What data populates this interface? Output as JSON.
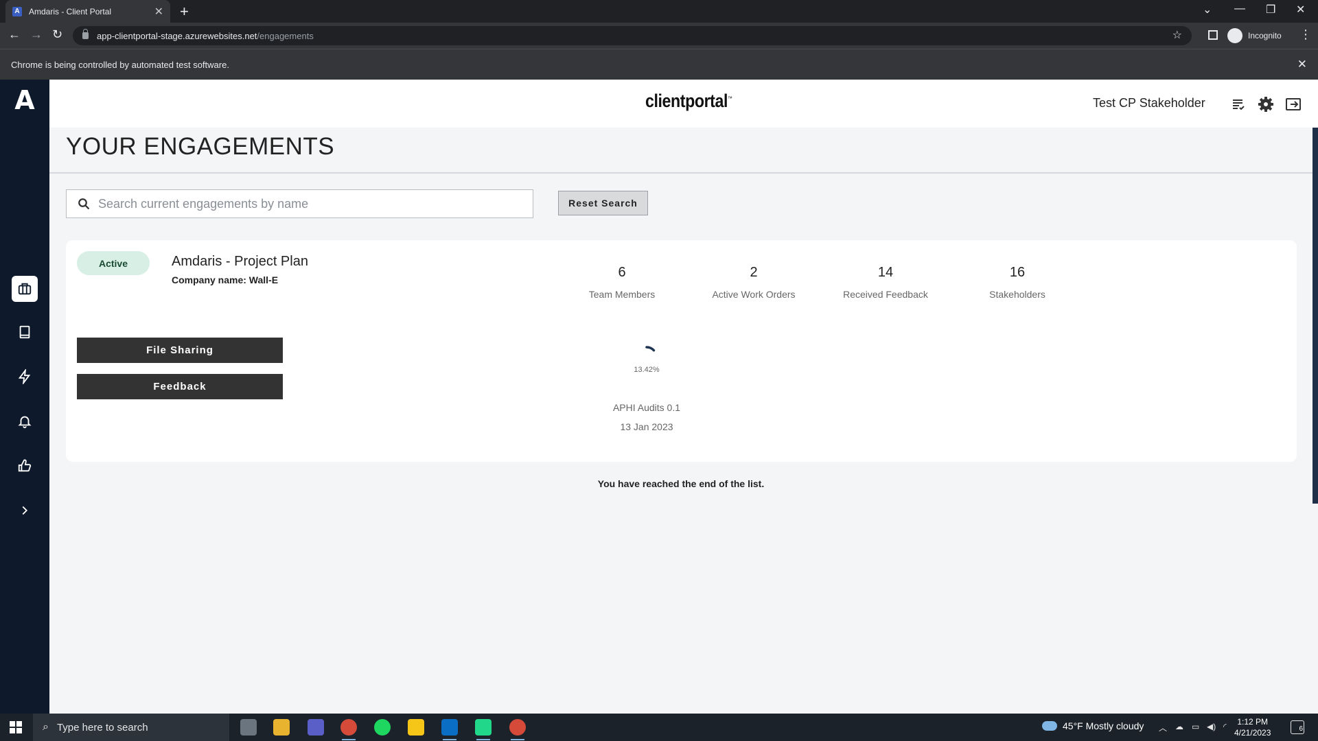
{
  "browser": {
    "tab_title": "Amdaris - Client Portal",
    "tab_favicon": "A",
    "url_host": "app-clientportal-stage.azurewebsites.net",
    "url_path": "/engagements",
    "profile_label": "Incognito",
    "infobar_text": "Chrome is being controlled by automated test software."
  },
  "app": {
    "logo_letter": "A",
    "brand_name": "clientportal",
    "brand_tm": "™",
    "user_name": "Test CP Stakeholder",
    "sidebar_icons": [
      "briefcase-icon",
      "book-icon",
      "lightning-icon",
      "bell-icon",
      "thumbs-up-icon",
      "chevron-right-icon"
    ],
    "header_icons": [
      "task-list-icon",
      "gear-icon",
      "logout-icon"
    ]
  },
  "page": {
    "title": "YOUR ENGAGEMENTS",
    "search_placeholder": "Search current engagements by name",
    "search_value": "",
    "reset_label": "Reset Search",
    "end_message": "You have reached the end of the list."
  },
  "engagement": {
    "status": "Active",
    "name": "Amdaris - Project Plan",
    "company": "Company name: Wall-E",
    "stats": [
      {
        "value": "6",
        "label": "Team Members"
      },
      {
        "value": "2",
        "label": "Active Work Orders"
      },
      {
        "value": "14",
        "label": "Received Feedback"
      },
      {
        "value": "16",
        "label": "Stakeholders"
      }
    ],
    "file_sharing_label": "File Sharing",
    "feedback_label": "Feedback",
    "progress_percent": 13.42,
    "progress_text": "13.42%",
    "milestone_name": "APHI Audits 0.1",
    "milestone_date": "13 Jan 2023"
  },
  "taskbar": {
    "search_placeholder": "Type here to search",
    "weather_text": "45°F  Mostly cloudy",
    "time": "1:12 PM",
    "date": "4/21/2023",
    "notification_count": "6"
  },
  "colors": {
    "sidebar": "#0e1a2b",
    "active_badge": "#d7efe4",
    "action_button": "#333333",
    "progress_arc": "#1f3552"
  }
}
